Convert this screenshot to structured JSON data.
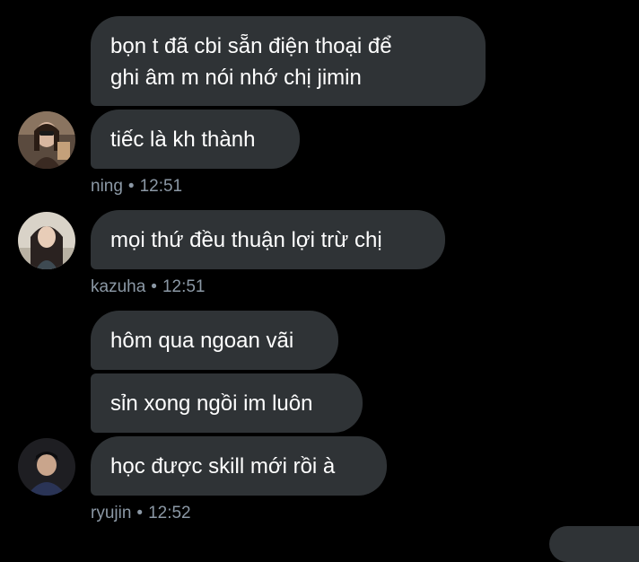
{
  "messages": [
    {
      "text": "bọn t đã cbi sẵn điện thoại để ghi âm m nói nhớ chị jimin",
      "line1": "bọn t đã cbi sẵn điện thoại để",
      "line2": "ghi âm m nói nhớ chị jimin"
    },
    {
      "text": "tiếc là kh thành"
    },
    {
      "text": "mọi thứ đều thuận lợi trừ chị"
    },
    {
      "text": "hôm qua ngoan vãi"
    },
    {
      "text": "sỉn xong ngồi im luôn"
    },
    {
      "text": "học được skill mới rồi à"
    }
  ],
  "meta": [
    {
      "name": "ning",
      "sep": "•",
      "time": "12:51"
    },
    {
      "name": "kazuha",
      "sep": "•",
      "time": "12:51"
    },
    {
      "name": "ryujin",
      "sep": "•",
      "time": "12:52"
    }
  ],
  "colors": {
    "background": "#000000",
    "bubble": "#2f3336",
    "text": "#ffffff",
    "meta": "#8b98a5"
  }
}
